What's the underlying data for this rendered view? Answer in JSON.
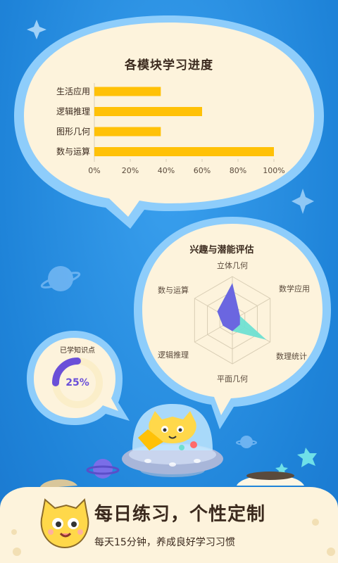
{
  "bar_chart": {
    "title": "各模块学习进度",
    "categories": [
      "生活应用",
      "逻辑推理",
      "图形几何",
      "数与运算"
    ],
    "values": [
      37,
      60,
      37,
      100
    ],
    "xticks": [
      "0%",
      "20%",
      "40%",
      "60%",
      "80%",
      "100%"
    ],
    "bar_color": "#ffc107"
  },
  "radar": {
    "title": "兴趣与潜能评估",
    "axes": [
      "立体几何",
      "数学应用",
      "数理统计",
      "平面几何",
      "逻辑推理",
      "数与运算"
    ],
    "series": [
      {
        "values": [
          0.85,
          0.2,
          0.2,
          0.25,
          0.25,
          0.4
        ],
        "color": "#6a5fe0"
      },
      {
        "values": [
          0.85,
          0.2,
          0.9,
          0.25,
          0.25,
          0.4
        ],
        "color": "#6fe0d2"
      }
    ]
  },
  "progress": {
    "title": "已学知识点",
    "value": 0.25,
    "label": "25%",
    "color": "#6a4fd8",
    "track_color": "#fbeec9"
  },
  "footer": {
    "headline": "每日练习，个性定制",
    "subline": "每天15分钟，养成良好学习习惯"
  },
  "chart_data": [
    {
      "type": "bar",
      "title": "各模块学习进度",
      "categories": [
        "生活应用",
        "逻辑推理",
        "图形几何",
        "数与运算"
      ],
      "values": [
        37,
        60,
        37,
        100
      ],
      "xlim": [
        0,
        100
      ],
      "xlabel": "",
      "ylabel": ""
    }
  ]
}
